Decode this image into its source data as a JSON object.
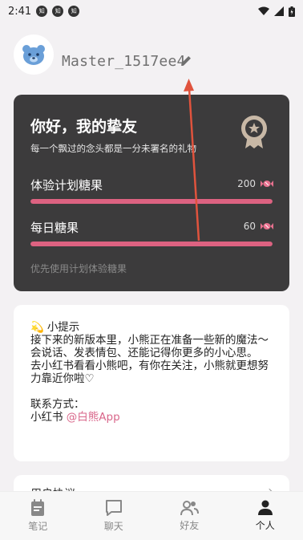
{
  "status_bar": {
    "time": "2:41",
    "notification_badges": [
      "知",
      "知",
      "知"
    ]
  },
  "profile": {
    "username": "Master_1517ee4"
  },
  "dark_card": {
    "greeting": "你好，我的挚友",
    "tagline": "每一个飘过的念头都是一分未署名的礼物",
    "experience_candy": {
      "label": "体验计划糖果",
      "value": "200",
      "progress": 1.0
    },
    "daily_candy": {
      "label": "每日糖果",
      "value": "60",
      "progress": 1.0
    },
    "footer_note": "优先使用计划体验糖果"
  },
  "tips_card": {
    "emoji": "💫",
    "title": "小提示",
    "paragraphs": [
      "接下来的新版本里，小熊正在准备一些新的魔法～",
      "会说话、发表情包、还能记得你更多的小心思。",
      "去小红书看看小熊吧，有你在关注，小熊就更想努力靠近你啦♡"
    ],
    "contact_label": "联系方式：",
    "contact_platform": "小红书",
    "contact_handle": "@白熊App"
  },
  "next_card": {
    "label": "用户协议"
  },
  "bottom_nav": {
    "items": [
      {
        "label": "笔记",
        "icon": "notebook-icon",
        "active": false
      },
      {
        "label": "聊天",
        "icon": "chat-icon",
        "active": false
      },
      {
        "label": "好友",
        "icon": "friends-icon",
        "active": false
      },
      {
        "label": "个人",
        "icon": "person-icon",
        "active": true
      }
    ]
  },
  "colors": {
    "accent": "#dd6281",
    "dark_card": "#3c3b3c",
    "annotation_arrow": "#e0533d",
    "link": "#d9668a"
  }
}
